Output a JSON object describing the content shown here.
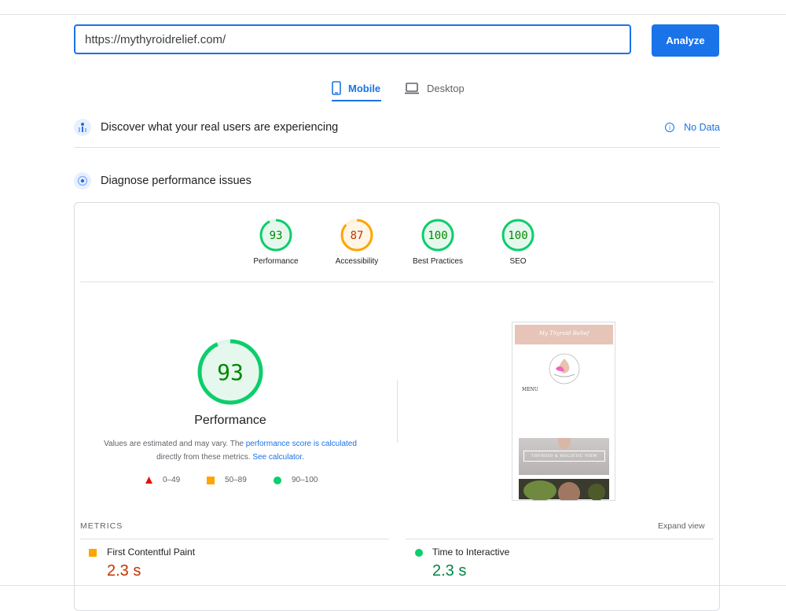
{
  "search": {
    "url": "https://mythyroidrelief.com/",
    "analyze_label": "Analyze"
  },
  "tabs": [
    {
      "label": "Mobile",
      "active": true
    },
    {
      "label": "Desktop",
      "active": false
    }
  ],
  "field_data": {
    "title": "Discover what your real users are experiencing",
    "status": "No Data"
  },
  "lab": {
    "title": "Diagnose performance issues"
  },
  "categories": [
    {
      "label": "Performance",
      "score": 93,
      "color": "#0cce6b"
    },
    {
      "label": "Accessibility",
      "score": 87,
      "color": "#ffa400"
    },
    {
      "label": "Best Practices",
      "score": 100,
      "color": "#0cce6b"
    },
    {
      "label": "SEO",
      "score": 100,
      "color": "#0cce6b"
    }
  ],
  "performance": {
    "score": "93",
    "title": "Performance",
    "note_part1": "Values are estimated and may vary. The ",
    "note_link1": "performance score is calculated",
    "note_part2": "directly from these metrics. ",
    "note_link2": "See calculator",
    "note_end": "."
  },
  "legend": [
    {
      "range": "0–49",
      "color": "#ff4e42",
      "shape": "triangle"
    },
    {
      "range": "50–89",
      "color": "#ffa400",
      "shape": "square"
    },
    {
      "range": "90–100",
      "color": "#0cce6b",
      "shape": "circle"
    }
  ],
  "screenshot": {
    "brand": "My Thyroid Relief",
    "menu": "MENU",
    "banner": "THYROID & HOLISTIC VIEW"
  },
  "metrics": {
    "label": "METRICS",
    "expand_label": "Expand view",
    "items": [
      {
        "name": "First Contentful Paint",
        "value": "2.3 s",
        "color": "#c33300",
        "marker": "#ffa400"
      },
      {
        "name": "Time to Interactive",
        "value": "2.3 s",
        "color": "#018642",
        "marker": "#0cce6b"
      }
    ]
  },
  "colors": {
    "accent": "#1a73e8",
    "pass": "#0cce6b",
    "average": "#ffa400",
    "fail": "#ff4e42"
  }
}
